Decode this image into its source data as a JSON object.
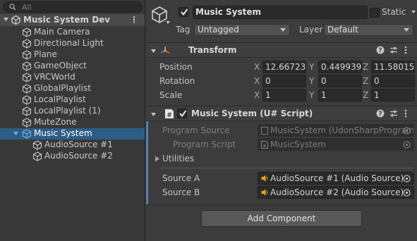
{
  "hierarchy": {
    "search": {
      "placeholder": "All"
    },
    "scene": {
      "label": "Music System Dev",
      "menu_glyph": "⋮"
    },
    "items": [
      {
        "label": "Main Camera"
      },
      {
        "label": "Directional Light"
      },
      {
        "label": "Plane"
      },
      {
        "label": "GameObject"
      },
      {
        "label": "VRCWorld"
      },
      {
        "label": "GlobalPlaylist"
      },
      {
        "label": "LocalPlaylist"
      },
      {
        "label": "LocalPlaylist (1)"
      },
      {
        "label": "MuteZone"
      },
      {
        "label": "Music System",
        "selected": true,
        "expanded": true
      },
      {
        "label": "AudioSource #1",
        "child": true
      },
      {
        "label": "AudioSource #2",
        "child": true
      }
    ]
  },
  "inspector": {
    "object_name": "Music System",
    "active_checked": true,
    "static_label": "Static",
    "static_checked": false,
    "tag_label": "Tag",
    "tag_value": "Untagged",
    "layer_label": "Layer",
    "layer_value": "Default",
    "transform": {
      "title": "Transform",
      "rows": [
        {
          "label": "Position",
          "x": "12.66723",
          "y": "0.449939",
          "z": "11.58015"
        },
        {
          "label": "Rotation",
          "x": "0",
          "y": "0",
          "z": "0"
        },
        {
          "label": "Scale",
          "x": "1",
          "y": "1",
          "z": "1"
        }
      ],
      "axis_x": "X",
      "axis_y": "Y",
      "axis_z": "Z"
    },
    "script_component": {
      "title": "Music System (U# Script)",
      "enabled_checked": true,
      "program_source_label": "Program Source",
      "program_source_value": "MusicSystem (UdonSharpProgram",
      "program_script_label": "Program Script",
      "program_script_value": "MusicSystem",
      "utilities_label": "Utilities",
      "source_a_label": "Source A",
      "source_a_value": "AudioSource #1 (Audio Source)",
      "source_b_label": "Source B",
      "source_b_value": "AudioSource #2 (Audio Source)"
    },
    "add_component_label": "Add Component"
  },
  "colors": {
    "panel_bg": "#383838",
    "inspector_bg": "#3c3c3c",
    "selection": "#2c5d87",
    "field_bg": "#2a2a2a",
    "audio_icon": "#e8a317"
  }
}
